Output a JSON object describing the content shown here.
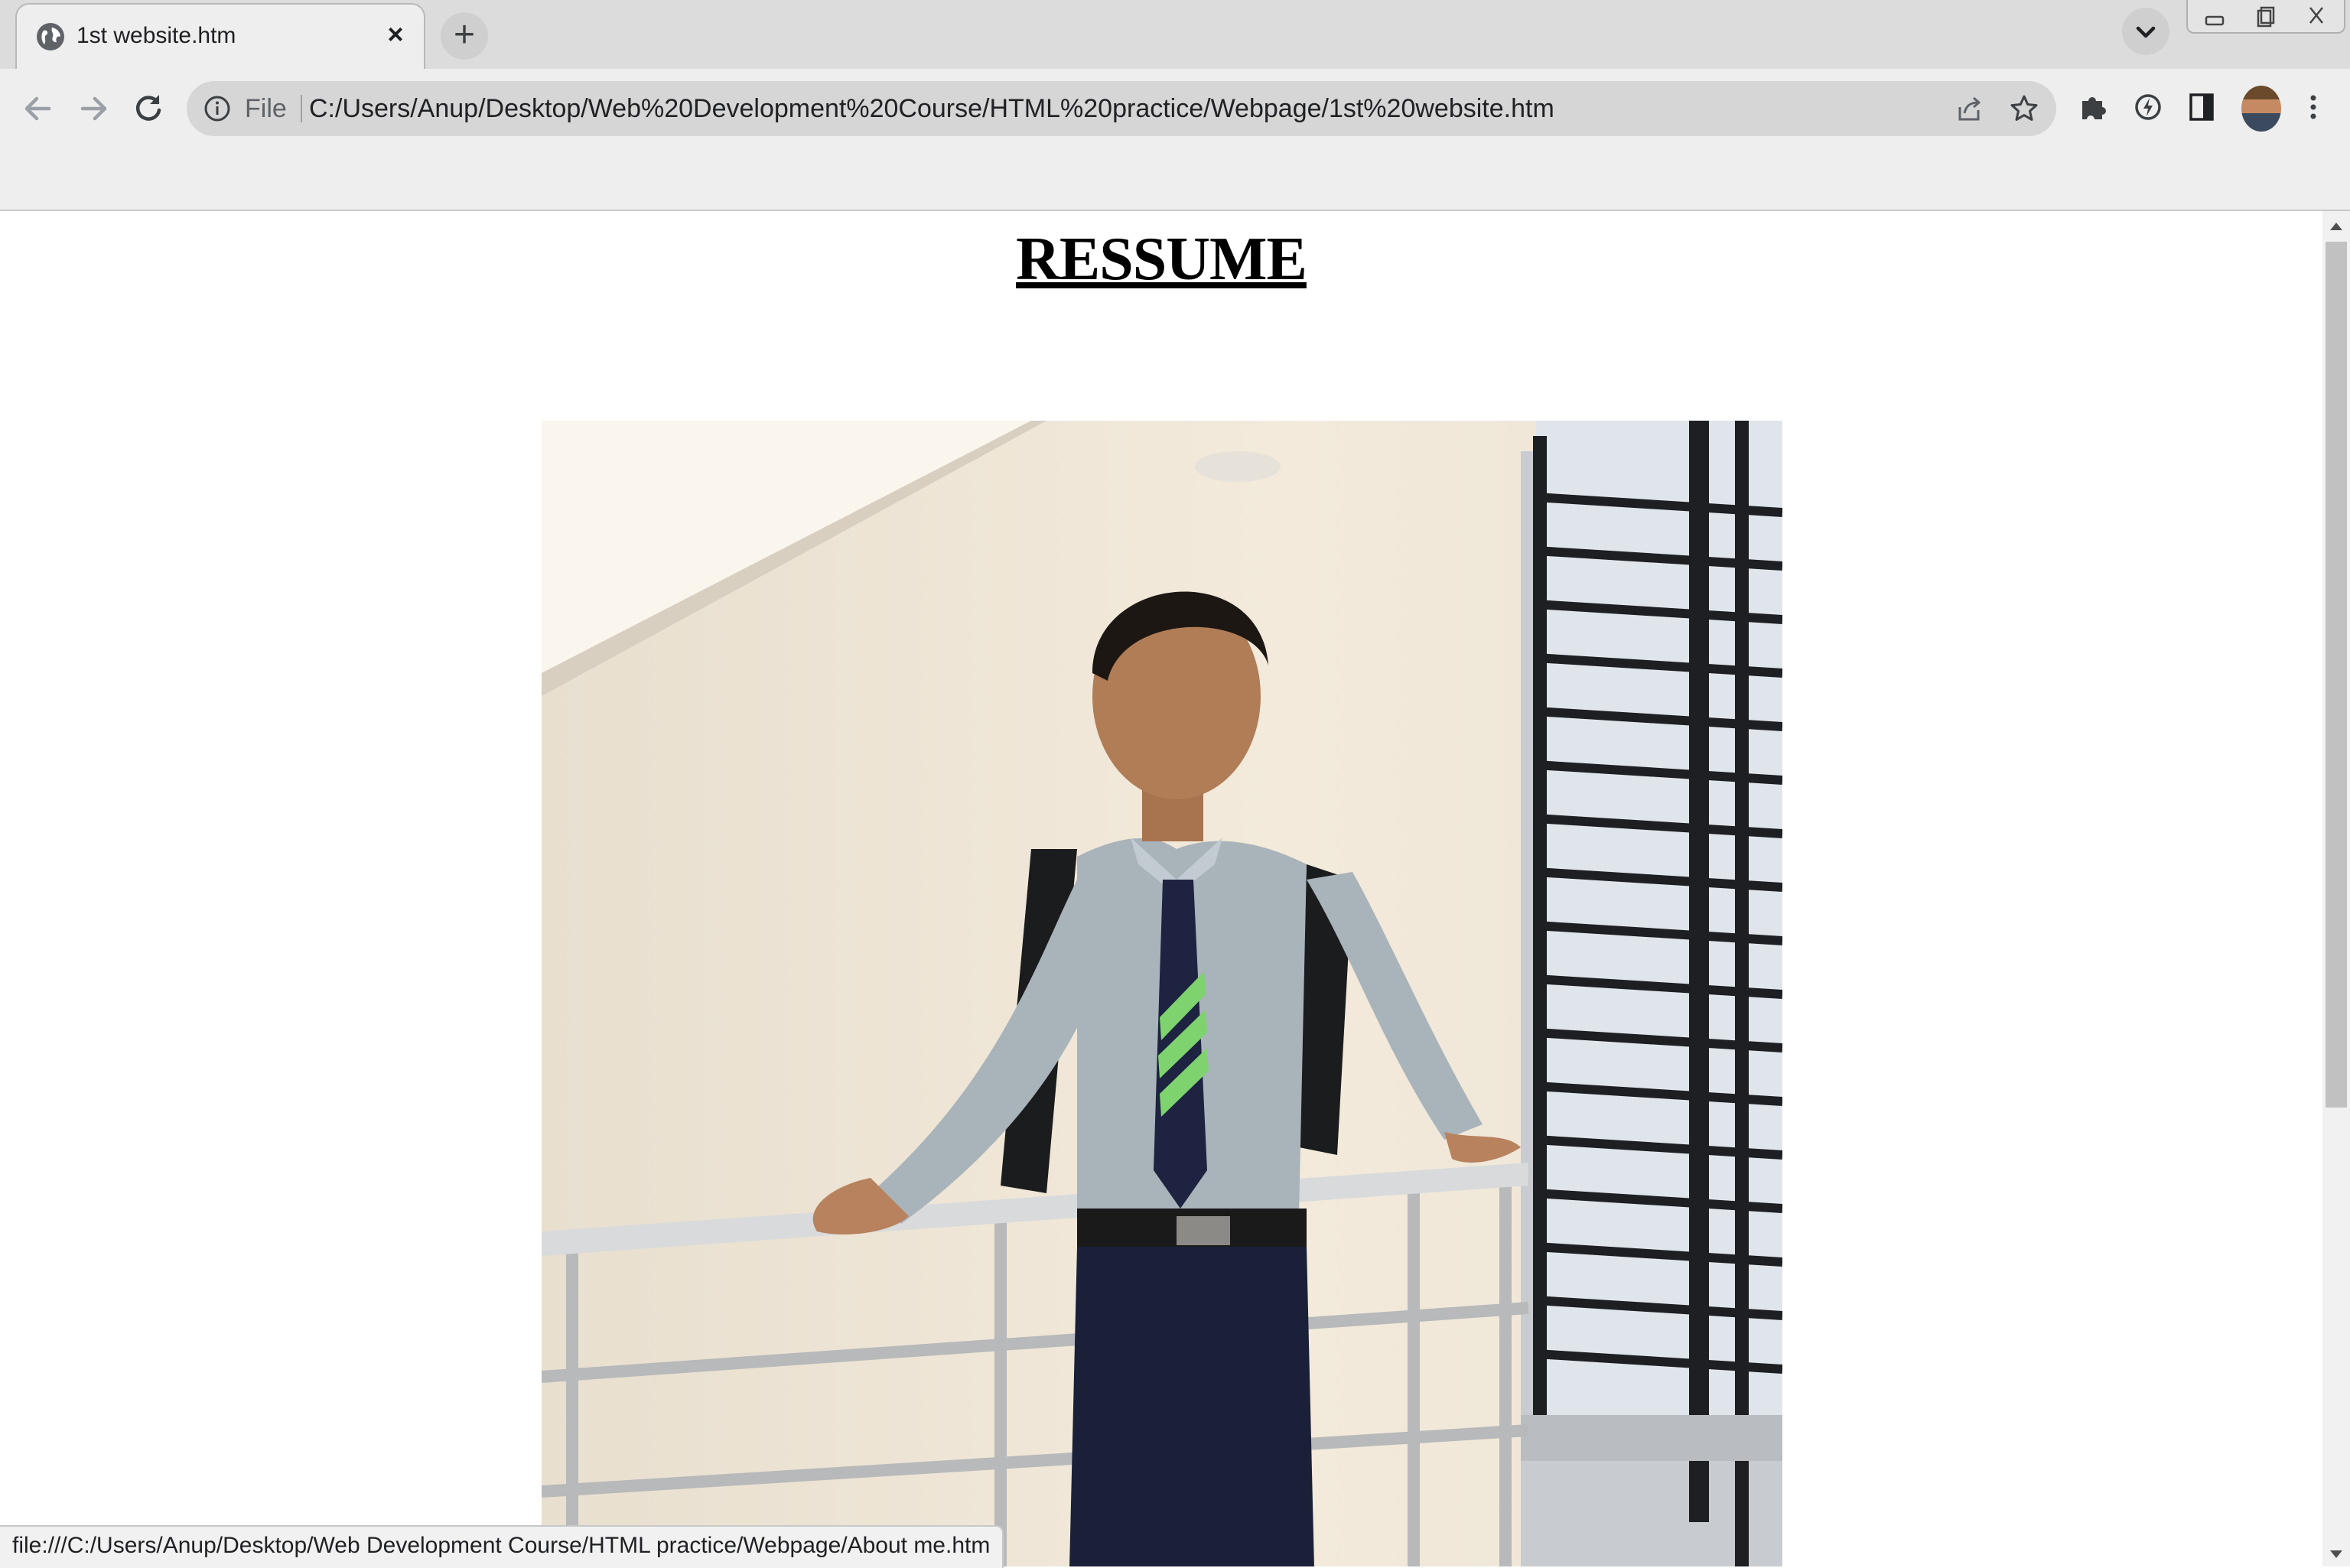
{
  "browser": {
    "tab": {
      "title": "1st website.htm",
      "close_glyph": "×",
      "favicon": "globe-icon"
    },
    "new_tab_glyph": "+",
    "omnibox": {
      "scheme_label": "File",
      "url": "C:/Users/Anup/Desktop/Web%20Development%20Course/HTML%20practice/Webpage/1st%20website.htm"
    },
    "status_url": "file:///C:/Users/Anup/Desktop/Web Development Course/HTML practice/Webpage/About me.htm"
  },
  "page": {
    "heading": "RESSUME"
  },
  "colors": {
    "tab_strip": "#dcdcdc",
    "toolbar": "#eeeeee",
    "omnibox": "#d6d6d6",
    "page_background": "#ffffff",
    "heading": "#000000"
  }
}
